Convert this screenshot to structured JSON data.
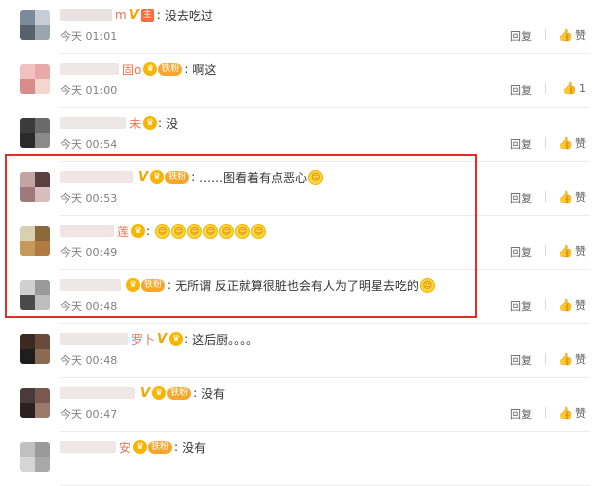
{
  "comments": [
    {
      "username": "m",
      "badges": [
        "V",
        "主"
      ],
      "text": "没去吃过",
      "time": "今天 01:01",
      "reply": "回复",
      "like_label": "赞",
      "like_count": "",
      "colors": {
        "avatar": [
          "#7b8b9c",
          "#c7cdd4",
          "#56616b",
          "#9aa5af"
        ],
        "blur": "#e9e2e2"
      },
      "emoji_count": 0
    },
    {
      "username": "固o",
      "badges": [
        "crown",
        "铁粉"
      ],
      "text": "啊这",
      "time": "今天 01:00",
      "reply": "回复",
      "like_label": "",
      "like_count": "1",
      "colors": {
        "avatar": [
          "#f2c1c1",
          "#e8a9a9",
          "#d98c8c",
          "#f5d5d0"
        ],
        "blur": "#efe6e6"
      },
      "emoji_count": 0
    },
    {
      "username": "未",
      "badges": [
        "crown"
      ],
      "text": "没",
      "time": "今天 00:54",
      "reply": "回复",
      "like_label": "赞",
      "like_count": "",
      "colors": {
        "avatar": [
          "#3b3b3b",
          "#6a6a6a",
          "#2a2a2a",
          "#8a8a8a"
        ],
        "blur": "#ede7e7"
      },
      "emoji_count": 0
    },
    {
      "username": "",
      "badges": [
        "V",
        "crown",
        "铁粉"
      ],
      "text": "……图看着有点恶心",
      "time": "今天 00:53",
      "reply": "回复",
      "like_label": "赞",
      "like_count": "",
      "colors": {
        "avatar": [
          "#c4a3a3",
          "#5a4040",
          "#a07a7a",
          "#d9bcbc"
        ],
        "blur": "#f1e6e6"
      },
      "emoji_count": 1
    },
    {
      "username": "莲",
      "badges": [
        "crown"
      ],
      "text": "",
      "time": "今天 00:49",
      "reply": "回复",
      "like_label": "赞",
      "like_count": "",
      "colors": {
        "avatar": [
          "#d8d0b0",
          "#8a6a3a",
          "#c49a5a",
          "#b07a40"
        ],
        "blur": "#f0e4e4"
      },
      "emoji_count": 7
    },
    {
      "username": "",
      "badges": [
        "crown",
        "铁粉"
      ],
      "text": "无所谓 反正就算很脏也会有人为了明星去吃的",
      "time": "今天 00:48",
      "reply": "回复",
      "like_label": "赞",
      "like_count": "",
      "colors": {
        "avatar": [
          "#d0d0d0",
          "#9a9a9a",
          "#4a4a4a",
          "#bdbdbd"
        ],
        "blur": "#efe7e7"
      },
      "emoji_count": 1
    },
    {
      "username": "罗卜",
      "badges": [
        "V",
        "crown"
      ],
      "text": "这后厨。。。。",
      "time": "今天 00:48",
      "reply": "回复",
      "like_label": "赞",
      "like_count": "",
      "colors": {
        "avatar": [
          "#3a2a20",
          "#6a4a3a",
          "#1e1e1e",
          "#8a6a50"
        ],
        "blur": "#ede6e6"
      },
      "emoji_count": 0
    },
    {
      "username": "",
      "badges": [
        "V",
        "crown",
        "铁粉"
      ],
      "text": "没有",
      "time": "今天 00:47",
      "reply": "回复",
      "like_label": "赞",
      "like_count": "",
      "colors": {
        "avatar": [
          "#4a3a3a",
          "#7a5a50",
          "#2a2020",
          "#9a7a6a"
        ],
        "blur": "#efe6e6"
      },
      "emoji_count": 0
    },
    {
      "username": "安",
      "badges": [
        "crown",
        "铁粉"
      ],
      "text": "没有",
      "time": "",
      "reply": "",
      "like_label": "",
      "like_count": "",
      "colors": {
        "avatar": [
          "#c0c0c0",
          "#9a9a9a",
          "#d5d5d5",
          "#a8a8a8"
        ],
        "blur": "#efe7e7"
      },
      "emoji_count": 0
    }
  ],
  "icons": {
    "like": "thumb-up-icon",
    "emoji": "laughing-emoji-icon"
  },
  "highlight_color": "#e03024"
}
